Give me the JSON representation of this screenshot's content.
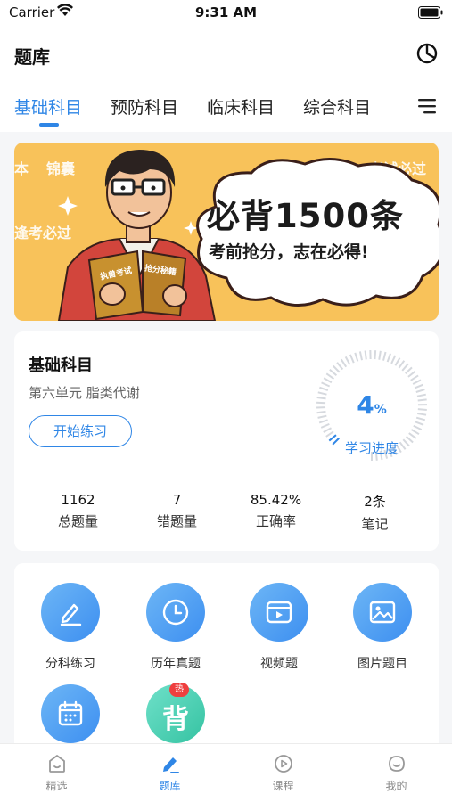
{
  "status_bar": {
    "carrier": "Carrier",
    "time": "9:31 AM"
  },
  "header": {
    "title": "题库",
    "stats_icon": "pie-chart-icon"
  },
  "tabs": [
    {
      "label": "基础科目",
      "active": true
    },
    {
      "label": "预防科目",
      "active": false
    },
    {
      "label": "临床科目",
      "active": false
    },
    {
      "label": "综合科目",
      "active": false
    }
  ],
  "banner": {
    "headline": "必背1500条",
    "subline": "考前抢分，志在必得!",
    "bg_texts": [
      "本",
      "锦囊",
      "逢考必过",
      "考试必过"
    ],
    "book_left": "执兽考试",
    "book_right": "抢分秘籍"
  },
  "progress": {
    "subject": "基础科目",
    "unit": "第六单元 脂类代谢",
    "start_button": "开始练习",
    "percent_number": "4",
    "percent_sign": "%",
    "percent_value": 4,
    "link": "学习进度",
    "stats": [
      {
        "value": "1162",
        "label": "总题量"
      },
      {
        "value": "7",
        "label": "错题量"
      },
      {
        "value": "85.42%",
        "label": "正确率"
      },
      {
        "value": "2条",
        "label": "笔记"
      }
    ]
  },
  "tools": [
    {
      "label": "分科练习",
      "icon": "pencil-icon"
    },
    {
      "label": "历年真题",
      "icon": "clock-icon"
    },
    {
      "label": "视频题",
      "icon": "video-icon"
    },
    {
      "label": "图片题目",
      "icon": "image-icon"
    },
    {
      "label": "",
      "icon": "calendar-icon"
    },
    {
      "label": "",
      "icon": "bei-icon",
      "char": "背",
      "badge": "热"
    }
  ],
  "bottom_nav": [
    {
      "label": "精选",
      "icon": "home-icon",
      "active": false
    },
    {
      "label": "题库",
      "icon": "edit-icon",
      "active": true
    },
    {
      "label": "课程",
      "icon": "play-icon",
      "active": false
    },
    {
      "label": "我的",
      "icon": "smile-icon",
      "active": false
    }
  ],
  "colors": {
    "accent": "#2f86e6",
    "banner": "#f8c25a",
    "hot": "#ee3f3f"
  }
}
